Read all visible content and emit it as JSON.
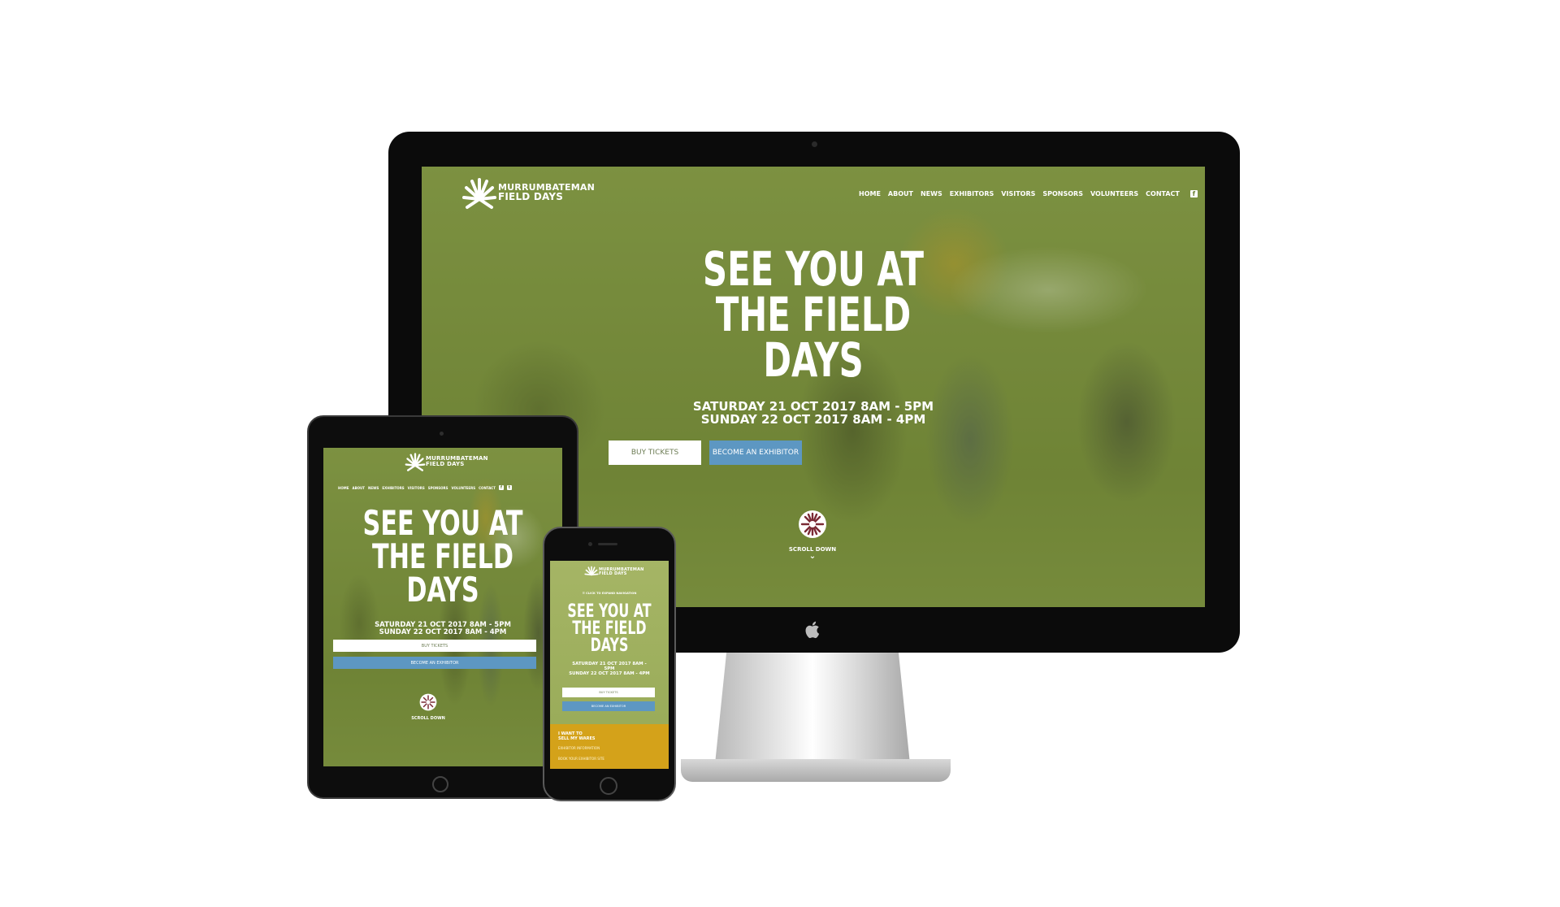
{
  "site": {
    "logo_line1": "MURRUMBATEMAN",
    "logo_line2": "FIELD DAYS",
    "nav": [
      "HOME",
      "ABOUT",
      "NEWS",
      "EXHIBITORS",
      "VISITORS",
      "SPONSORS",
      "VOLUNTEERS",
      "CONTACT"
    ],
    "social": {
      "facebook": "f",
      "twitter": "t"
    },
    "hero": {
      "title_line1": "SEE YOU AT",
      "title_line2": "THE FIELD",
      "title_line3": "DAYS",
      "date_line1": "SATURDAY 21 OCT 2017 8AM - 5PM",
      "date_line2": "SUNDAY 22 OCT 2017 8AM - 4PM"
    },
    "buttons": {
      "buy_tickets": "BUY TICKETS",
      "become_exhibitor": "BECOME AN EXHIBITOR"
    },
    "scroll_down": "SCROLL DOWN",
    "scroll_arrow": "⌄"
  },
  "phone": {
    "expand_nav": "☰ CLICK TO EXPAND NAVIGATION",
    "date_line1a": "SATURDAY 21 OCT 2017 8AM -",
    "date_line1b": "5PM",
    "date_line2": "SUNDAY 22 OCT 2017 8AM - 4PM",
    "panel_heading1": "I WANT TO",
    "panel_heading2": "SELL MY WARES",
    "panel_link1": "EXHIBITOR INFORMATION",
    "panel_link2": "BOOK YOUR EXHIBITOR SITE"
  },
  "colors": {
    "site_green": "#73883b",
    "button_blue": "#5d97c2",
    "panel_yellow": "#d4a21a",
    "device_black": "#0b0b0b"
  },
  "icons": [
    "logo-sun-icon",
    "facebook-icon",
    "twitter-icon",
    "scroll-flower-icon",
    "apple-logo-icon",
    "camera-icon",
    "home-button-icon"
  ]
}
